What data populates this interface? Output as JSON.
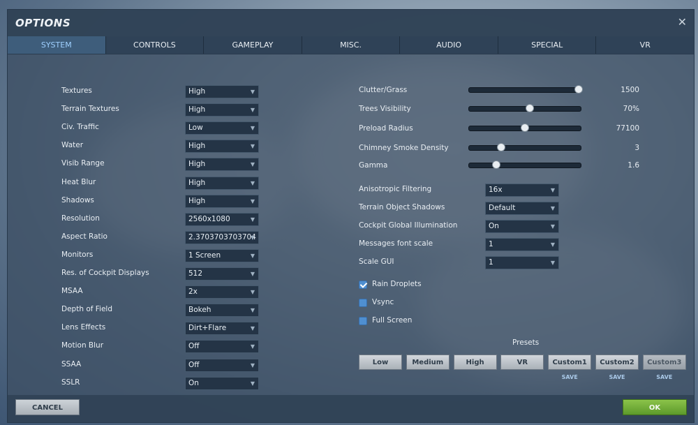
{
  "window": {
    "title": "OPTIONS",
    "close_icon": "close-icon"
  },
  "tabs": [
    {
      "label": "SYSTEM",
      "active": true
    },
    {
      "label": "CONTROLS"
    },
    {
      "label": "GAMEPLAY"
    },
    {
      "label": "MISC."
    },
    {
      "label": "AUDIO"
    },
    {
      "label": "SPECIAL"
    },
    {
      "label": "VR"
    }
  ],
  "left_settings": [
    {
      "label": "Textures",
      "value": "High"
    },
    {
      "label": "Terrain Textures",
      "value": "High"
    },
    {
      "label": "Civ. Traffic",
      "value": "Low"
    },
    {
      "label": "Water",
      "value": "High"
    },
    {
      "label": "Visib Range",
      "value": "High"
    },
    {
      "label": "Heat Blur",
      "value": "High"
    },
    {
      "label": "Shadows",
      "value": "High"
    },
    {
      "label": "Resolution",
      "value": "2560x1080"
    },
    {
      "label": "Aspect Ratio",
      "value": "2.3703703703704"
    },
    {
      "label": "Monitors",
      "value": "1 Screen"
    },
    {
      "label": "Res. of Cockpit Displays",
      "value": "512"
    },
    {
      "label": "MSAA",
      "value": "2x"
    },
    {
      "label": "Depth of Field",
      "value": "Bokeh"
    },
    {
      "label": "Lens Effects",
      "value": "Dirt+Flare"
    },
    {
      "label": "Motion Blur",
      "value": "Off"
    },
    {
      "label": "SSAA",
      "value": "Off"
    },
    {
      "label": "SSLR",
      "value": "On"
    }
  ],
  "sliders": [
    {
      "label": "Clutter/Grass",
      "value": "1500",
      "fraction": 1.0
    },
    {
      "label": "Trees Visibility",
      "value": "70%",
      "fraction": 0.56
    },
    {
      "label": "Preload Radius",
      "value": "77100",
      "fraction": 0.51
    },
    {
      "label": "Chimney Smoke Density",
      "value": "3",
      "fraction": 0.3
    },
    {
      "label": "Gamma",
      "value": "1.6",
      "fraction": 0.25
    }
  ],
  "right_settings": [
    {
      "label": "Anisotropic Filtering",
      "value": "16x"
    },
    {
      "label": "Terrain Object Shadows",
      "value": "Default"
    },
    {
      "label": "Cockpit Global Illumination",
      "value": "On"
    },
    {
      "label": "Messages font scale",
      "value": "1"
    },
    {
      "label": "Scale GUI",
      "value": "1"
    }
  ],
  "checkboxes": [
    {
      "label": "Rain Droplets",
      "checked": true
    },
    {
      "label": "Vsync",
      "checked": false
    },
    {
      "label": "Full Screen",
      "checked": false
    }
  ],
  "presets": {
    "title": "Presets",
    "buttons": [
      {
        "label": "Low"
      },
      {
        "label": "Medium"
      },
      {
        "label": "High"
      },
      {
        "label": "VR"
      },
      {
        "label": "Custom1",
        "save": "SAVE"
      },
      {
        "label": "Custom2",
        "save": "SAVE"
      },
      {
        "label": "Custom3",
        "save": "SAVE",
        "disabled": true
      }
    ]
  },
  "footer": {
    "cancel": "CANCEL",
    "ok": "OK"
  },
  "colors": {
    "accent_tab": "#9fd0ff",
    "ok_green": "#6aa832",
    "checkbox_blue": "#4f8fd1"
  }
}
